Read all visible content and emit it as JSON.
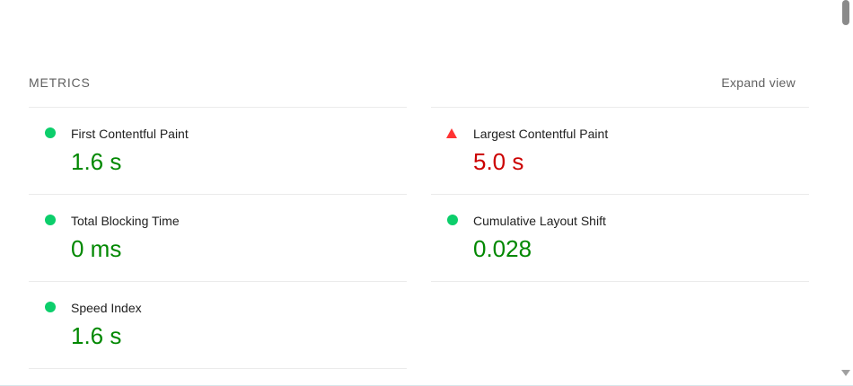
{
  "header": {
    "title": "METRICS",
    "expand_label": "Expand view"
  },
  "colors": {
    "good": "#008800",
    "bad": "#cc0000",
    "good_indicator": "#0cce6b",
    "bad_indicator": "#ff3333"
  },
  "metrics": {
    "fcp": {
      "name": "First Contentful Paint",
      "value": "1.6 s",
      "status": "good",
      "indicator": "green-circle-icon"
    },
    "lcp": {
      "name": "Largest Contentful Paint",
      "value": "5.0 s",
      "status": "bad",
      "indicator": "red-triangle-icon"
    },
    "tbt": {
      "name": "Total Blocking Time",
      "value": "0 ms",
      "status": "good",
      "indicator": "green-circle-icon"
    },
    "cls": {
      "name": "Cumulative Layout Shift",
      "value": "0.028",
      "status": "good",
      "indicator": "green-circle-icon"
    },
    "si": {
      "name": "Speed Index",
      "value": "1.6 s",
      "status": "good",
      "indicator": "green-circle-icon"
    }
  }
}
